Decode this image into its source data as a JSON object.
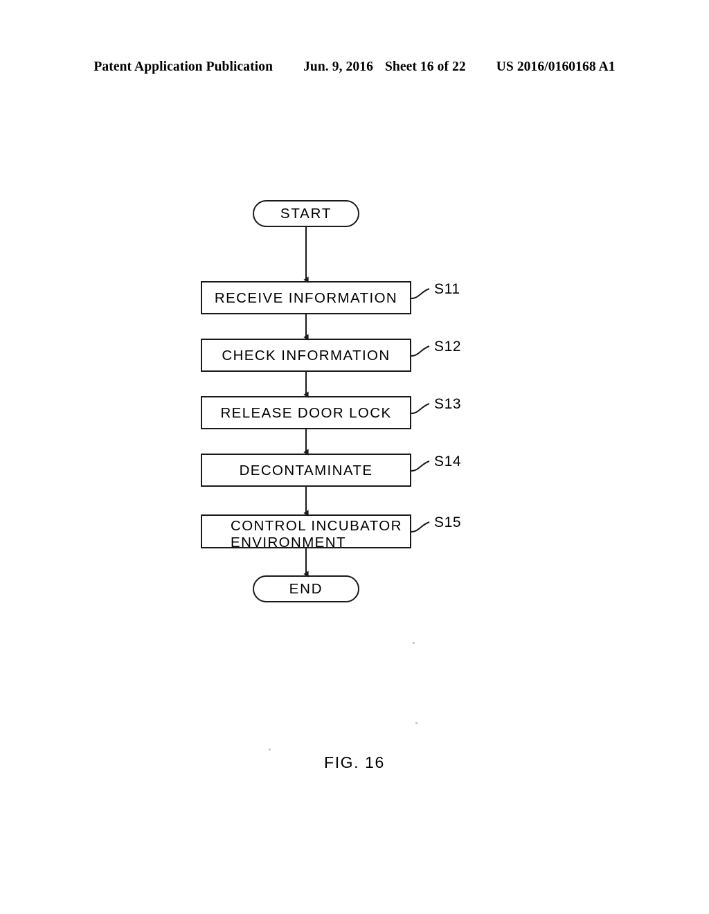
{
  "header": {
    "publication": "Patent Application Publication",
    "date": "Jun. 9, 2016",
    "sheet": "Sheet 16 of 22",
    "patent_number": "US 2016/0160168 A1"
  },
  "figure": {
    "caption": "FIG. 16",
    "type": "flowchart",
    "start_terminal": "START",
    "end_terminal": "END",
    "steps": [
      {
        "tag": "S11",
        "label": "RECEIVE INFORMATION"
      },
      {
        "tag": "S12",
        "label": "CHECK INFORMATION"
      },
      {
        "tag": "S13",
        "label": "RELEASE DOOR LOCK"
      },
      {
        "tag": "S14",
        "label": "DECONTAMINATE"
      },
      {
        "tag": "S15",
        "label_line1": "CONTROL INCUBATOR",
        "label_line2": "ENVIRONMENT"
      }
    ]
  }
}
